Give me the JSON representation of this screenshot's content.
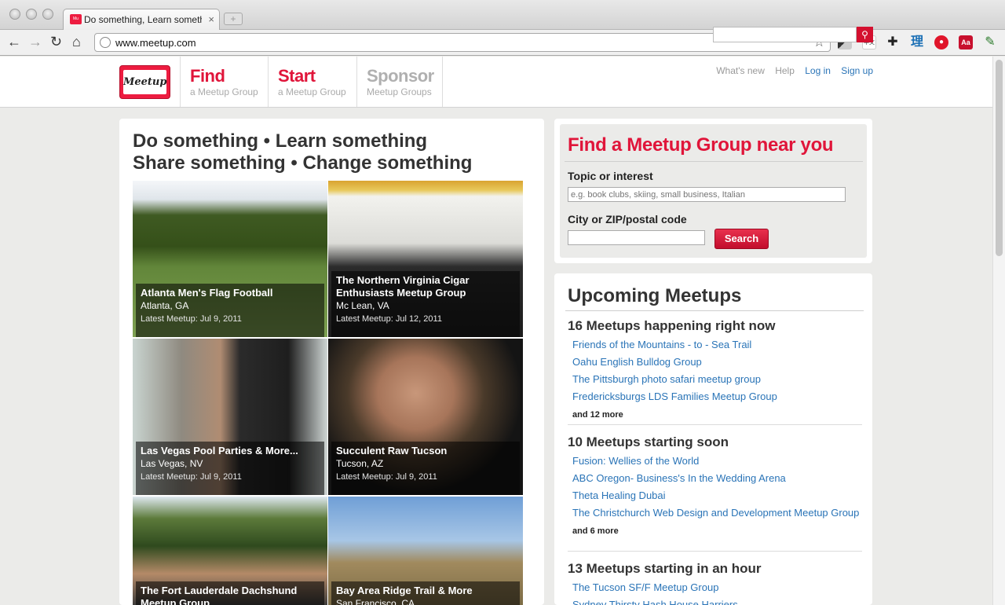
{
  "browser": {
    "tab_title": "Do something, Learn something",
    "tab_close": "×",
    "new_tab": "+",
    "back": "←",
    "forward": "→",
    "reload": "↻",
    "home": "⌂",
    "url": "www.meetup.com",
    "bookmark_star": "☆",
    "extensions": [
      "extension-icon",
      "extension-icon",
      "puzzle-icon",
      "dictionary-icon",
      "stop-icon",
      "acrobat-icon",
      "wrench-icon"
    ]
  },
  "header": {
    "logo_text": "Meetup",
    "nav": [
      {
        "big": "Find",
        "small": "a Meetup Group",
        "color": "#e0153a"
      },
      {
        "big": "Start",
        "small": "a Meetup Group",
        "color": "#e0153a"
      },
      {
        "big": "Sponsor",
        "small": "Meetup Groups",
        "color": "#b0b0b0"
      }
    ],
    "whats_new": "What's new",
    "help": "Help",
    "login": "Log in",
    "signup": "Sign up",
    "search_icon": "⚲"
  },
  "hero": {
    "line1": "Do something • Learn something",
    "line2": "Share something • Change something",
    "tiles": [
      {
        "title": "Atlanta Men's Flag Football",
        "location": "Atlanta, GA",
        "date": "Latest Meetup: Jul 9, 2011"
      },
      {
        "title": "The Northern Virginia Cigar Enthusiasts Meetup Group",
        "location": "Mc Lean, VA",
        "date": "Latest Meetup: Jul 12, 2011"
      },
      {
        "title": "Las Vegas Pool Parties & More...",
        "location": "Las Vegas, NV",
        "date": "Latest Meetup: Jul 9, 2011"
      },
      {
        "title": "Succulent Raw Tucson",
        "location": "Tucson, AZ",
        "date": "Latest Meetup: Jul 9, 2011"
      },
      {
        "title": "The Fort Lauderdale Dachshund Meetup Group",
        "location": "",
        "date": ""
      },
      {
        "title": "Bay Area Ridge Trail & More",
        "location": "San Francisco, CA",
        "date": ""
      }
    ]
  },
  "find": {
    "title": "Find a Meetup Group near you",
    "topic_label": "Topic or interest",
    "topic_placeholder": "e.g. book clubs, skiing, small business, Italian",
    "city_label": "City or ZIP/postal code",
    "city_value": "",
    "search_button": "Search"
  },
  "upcoming": {
    "title": "Upcoming Meetups",
    "groups": [
      {
        "heading": "16 Meetups happening right now",
        "links": [
          "Friends of the Mountains - to - Sea Trail",
          "Oahu English Bulldog Group",
          "The Pittsburgh photo safari meetup group",
          "Fredericksburgs LDS Families Meetup Group"
        ],
        "more": "and 12 more"
      },
      {
        "heading": "10 Meetups starting soon",
        "links": [
          "Fusion: Wellies of the World",
          "ABC Oregon- Business's In the Wedding Arena",
          "Theta Healing Dubai",
          "The Christchurch Web Design and Development Meetup Group"
        ],
        "more": "and 6 more"
      },
      {
        "heading": "13 Meetups starting in an hour",
        "links": [
          "The Tucson SF/F Meetup Group",
          "Sydney Thirsty Hash House Harriers"
        ],
        "more": ""
      }
    ]
  },
  "colors": {
    "brand_red": "#e0153a",
    "link_blue": "#2a74b7"
  }
}
